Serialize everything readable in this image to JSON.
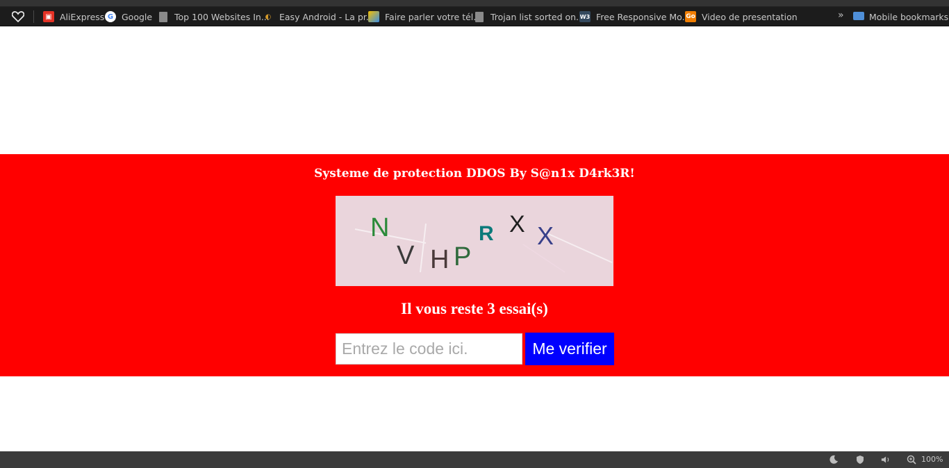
{
  "bookmarks": {
    "items": [
      {
        "label": "AliExpress",
        "icon": "aliexpress-icon"
      },
      {
        "label": "Google",
        "icon": "google-icon"
      },
      {
        "label": "Top 100 Websites In...",
        "icon": "document-icon"
      },
      {
        "label": "Easy Android - La pr...",
        "icon": "android-icon"
      },
      {
        "label": "Faire parler votre tél...",
        "icon": "bookmark-icon"
      },
      {
        "label": "Trojan list sorted on...",
        "icon": "document-icon"
      },
      {
        "label": "Free Responsive Mo...",
        "icon": "w3-icon"
      },
      {
        "label": "Video de presentation",
        "icon": "go-icon"
      }
    ],
    "mobile_label": "Mobile bookmarks"
  },
  "protection": {
    "title": "Systeme de protection DDOS By S@n1x D4rk3R!",
    "captcha_text": "NVHPRXX",
    "tries_text": "Il vous reste 3 essai(s)",
    "input_placeholder": "Entrez le code ici.",
    "input_value": "",
    "button_label": "Me verifier"
  },
  "status_bar": {
    "zoom": "100%"
  },
  "colors": {
    "panel_bg": "#ff0000",
    "button_bg": "#0000ff",
    "captcha_bg": "#ead5dc"
  }
}
